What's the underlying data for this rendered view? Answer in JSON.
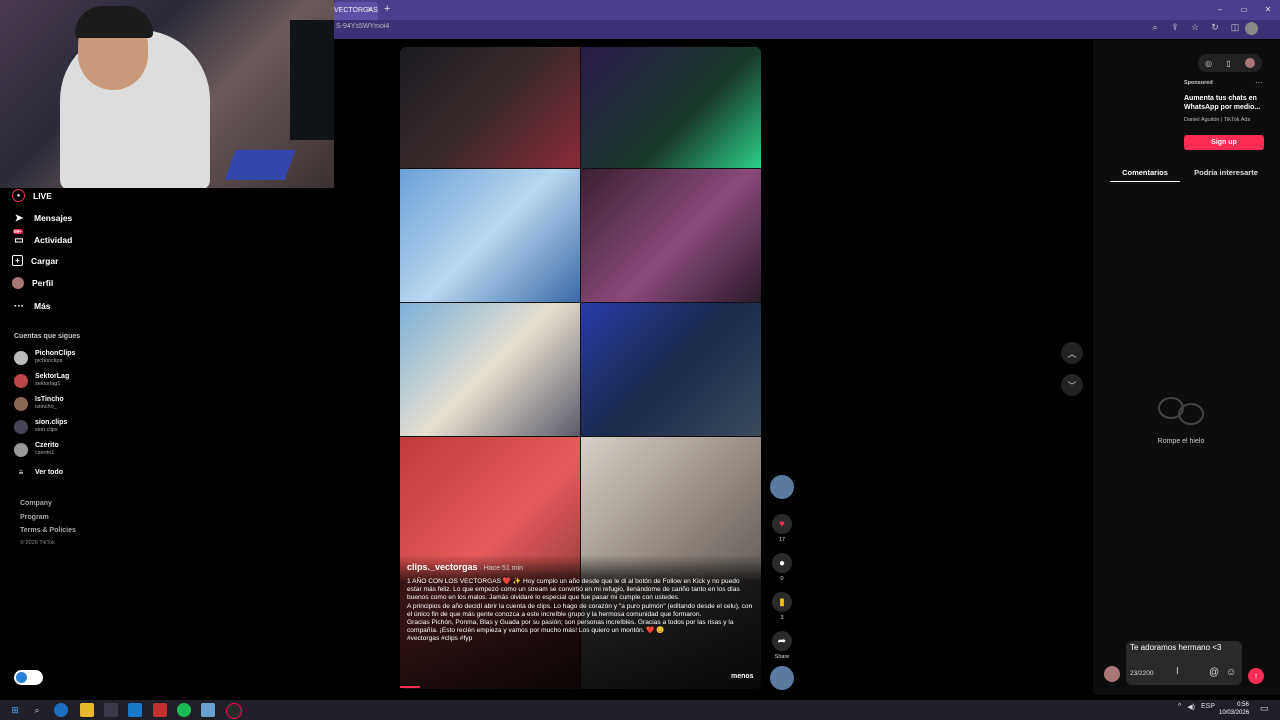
{
  "browser": {
    "tab_title": "VECTORGAS",
    "tab_close": "×",
    "new_tab": "+",
    "url_fragment": "S-94Ys5WYmoi4",
    "window_controls": [
      "–",
      "▭",
      "✕"
    ]
  },
  "sidebar": {
    "nav": [
      {
        "label": "LIVE",
        "icon": "live-icon"
      },
      {
        "label": "Mensajes",
        "icon": "message-icon"
      },
      {
        "label": "Actividad",
        "icon": "activity-icon",
        "badge": "99+"
      },
      {
        "label": "Cargar",
        "icon": "upload-icon"
      },
      {
        "label": "Perfil",
        "icon": "profile-icon"
      },
      {
        "label": "Más",
        "icon": "more-icon"
      }
    ],
    "following_title": "Cuentas que sigues",
    "following": [
      {
        "name": "PichonClips",
        "handle": "pichonclips"
      },
      {
        "name": "SektorLag",
        "handle": "sektorlag1"
      },
      {
        "name": "IsTincho",
        "handle": "istincho_"
      },
      {
        "name": "sion.clips",
        "handle": "sion.clips"
      },
      {
        "name": "Czerito",
        "handle": "czerito1"
      }
    ],
    "see_all": "Ver todo",
    "footer": [
      "Company",
      "Program",
      "Terms & Policies"
    ],
    "copyright": "© 2026 TikTok"
  },
  "video": {
    "author": "clips._vectorgas",
    "time": " · Hace 51 min",
    "description": [
      "1 AÑO CON LOS VECTORGAS ❤️ ✨ Hoy cumplo un año desde que le di al botón de Follow en Kick y no puedo estar más feliz. Lo que empezó como un stream se convirtió en mi refugio, llenándome de cariño tanto en los días buenos como en los malos. Jamás olvidaré lo especial que fue pasar mi cumple con ustedes.",
      "A principios de año decidí abrir la cuenta de clips. Lo hago de corazón y \"a puro pulmón\" (editando desde el celu), con el único fin de que más gente conozca a este increíble grupo y la hermosa comunidad que formaron.",
      "Gracias Pichón, Ponma, Blas y Guada por su pasión; son personas increíbles. Gracias a todos por las risas y la compañía. ¡Esto recién empieza y vamos por mucho más! Los quiero un montón. ❤️ 😊",
      "#vectorgas #clips #fyp"
    ],
    "less": "menos"
  },
  "actions": {
    "likes": "17",
    "comments": "0",
    "saves": "3",
    "share": "Share"
  },
  "panel": {
    "ad": {
      "sponsored": "Sponsored",
      "title": "Aumenta tus chats en WhatsApp por medio...",
      "advertiser": "Daniel Aguitón | TikTok Ads",
      "cta": "Sign up"
    },
    "tabs": [
      "Comentarios",
      "Podría interesarte"
    ],
    "empty": "Rompe el hielo",
    "comment_input": {
      "value": "Te adoramos hermano <3",
      "counter": "23/2200"
    }
  },
  "taskbar": {
    "lang": "ESP",
    "time": "0:56",
    "date": "10/03/2026"
  },
  "colors": {
    "accent": "#fe2c55",
    "chrome": "#4a3f8f",
    "background": "#000000"
  }
}
